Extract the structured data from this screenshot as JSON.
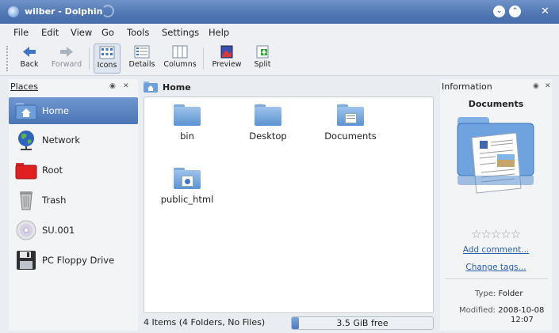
{
  "window": {
    "title": "wilber - Dolphin"
  },
  "menu": [
    "File",
    "Edit",
    "View",
    "Go",
    "Tools",
    "Settings",
    "Help"
  ],
  "toolbar": {
    "back": "Back",
    "forward": "Forward",
    "icons": "Icons",
    "details": "Details",
    "columns": "Columns",
    "preview": "Preview",
    "split": "Split"
  },
  "places": {
    "title": "Places",
    "items": [
      {
        "label": "Home",
        "icon": "home-folder-icon"
      },
      {
        "label": "Network",
        "icon": "network-globe-icon"
      },
      {
        "label": "Root",
        "icon": "root-folder-icon"
      },
      {
        "label": "Trash",
        "icon": "trash-icon"
      },
      {
        "label": "SU.001",
        "icon": "cdrom-icon"
      },
      {
        "label": "PC Floppy Drive",
        "icon": "floppy-icon"
      }
    ]
  },
  "breadcrumb": {
    "label": "Home"
  },
  "files": [
    {
      "name": "bin",
      "icon": "folder-icon"
    },
    {
      "name": "Desktop",
      "icon": "folder-icon"
    },
    {
      "name": "Documents",
      "icon": "documents-folder-icon"
    },
    {
      "name": "public_html",
      "icon": "web-folder-icon"
    }
  ],
  "status": {
    "summary": "4 Items (4 Folders, No Files)",
    "free_label": "3.5 GiB free",
    "used_fraction": 0.05
  },
  "info": {
    "title": "Information",
    "name": "Documents",
    "add_comment": "Add comment...",
    "change_tags": "Change tags...",
    "type_label": "Type:",
    "type_value": "Folder",
    "modified_label": "Modified:",
    "modified_date": "2008-10-08",
    "modified_time": "12:07",
    "rating": 0
  },
  "colors": {
    "accent": "#4b75b7",
    "titlebar": "#5a80bb"
  }
}
